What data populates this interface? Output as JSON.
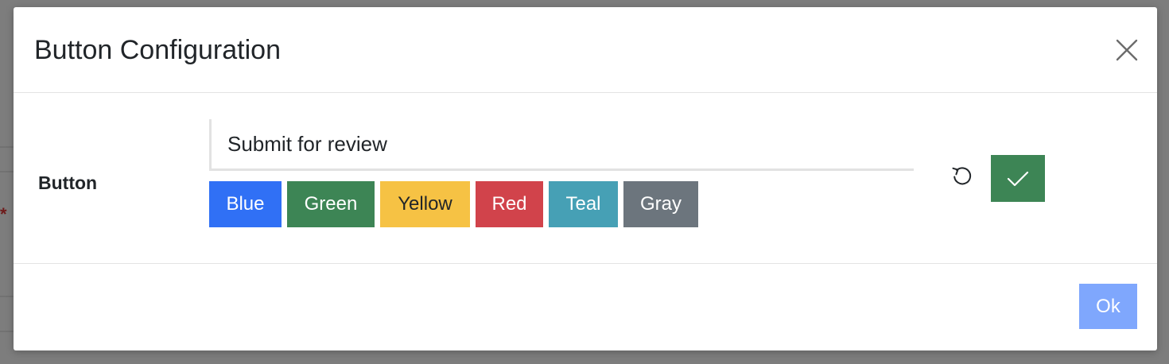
{
  "modal": {
    "title": "Button Configuration",
    "close_icon": "close-icon"
  },
  "field": {
    "label": "Button",
    "value": "Submit for review"
  },
  "colors": [
    {
      "label": "Blue",
      "bg": "#3070f5",
      "fg": "#ffffff",
      "width": 91
    },
    {
      "label": "Green",
      "bg": "#3d8555",
      "fg": "#ffffff",
      "width": 110
    },
    {
      "label": "Yellow",
      "bg": "#f6c244",
      "fg": "#212529",
      "width": 113
    },
    {
      "label": "Red",
      "bg": "#d1434b",
      "fg": "#ffffff",
      "width": 85
    },
    {
      "label": "Teal",
      "bg": "#46a0b5",
      "fg": "#ffffff",
      "width": 87
    },
    {
      "label": "Gray",
      "bg": "#6c757d",
      "fg": "#ffffff",
      "width": 94
    }
  ],
  "actions": {
    "reset_icon": "undo-icon",
    "confirm_icon": "check-icon",
    "confirm_color": "#3d8555"
  },
  "footer": {
    "ok_label": "Ok",
    "ok_color": "#7fa7fd"
  }
}
